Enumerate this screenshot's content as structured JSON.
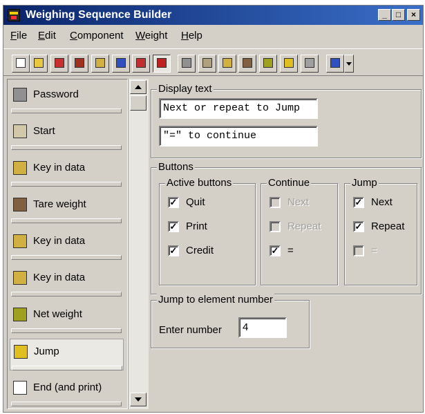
{
  "window": {
    "title": "Weighing Sequence Builder",
    "controls": {
      "minimize": "_",
      "maximize": "□",
      "close": "×"
    }
  },
  "menu": [
    {
      "pre": "",
      "u": "F",
      "post": "ile"
    },
    {
      "pre": "",
      "u": "E",
      "post": "dit"
    },
    {
      "pre": "",
      "u": "C",
      "post": "omponent"
    },
    {
      "pre": "",
      "u": "W",
      "post": "eight"
    },
    {
      "pre": "",
      "u": "H",
      "post": "elp"
    }
  ],
  "toolbar": {
    "buttons": [
      {
        "name": "new-file-icon",
        "color": "#ffffff"
      },
      {
        "name": "open-folder-icon",
        "color": "#e8c840"
      },
      {
        "name": "save-icon",
        "color": "#c83030"
      },
      {
        "name": "delete-icon",
        "color": "#a03020"
      },
      {
        "name": "properties-icon",
        "color": "#d0b040"
      },
      {
        "name": "move-up-icon",
        "color": "#3050c0"
      },
      {
        "name": "move-down-icon",
        "color": "#c03030"
      },
      {
        "name": "pointer-icon",
        "color": "#c02020"
      },
      {
        "name": "password-tool-icon",
        "color": "#909090"
      },
      {
        "name": "start-tool-icon",
        "color": "#b0a080"
      },
      {
        "name": "key-in-data-tool-icon",
        "color": "#d0b040"
      },
      {
        "name": "tare-weight-tool-icon",
        "color": "#806040"
      },
      {
        "name": "net-weight-tool-icon",
        "color": "#a0a020"
      },
      {
        "name": "jump-tool-icon",
        "color": "#e0c020"
      },
      {
        "name": "end-print-tool-icon",
        "color": "#a0a0a0"
      },
      {
        "name": "text-tool-icon",
        "color": "#3050c0"
      }
    ]
  },
  "components": [
    {
      "label": "Password",
      "icon": "password-icon",
      "color": "#909090"
    },
    {
      "label": "Start",
      "icon": "start-icon",
      "color": "#d0c8a8"
    },
    {
      "label": "Key in data",
      "icon": "key-in-data-icon",
      "color": "#d0b040"
    },
    {
      "label": "Tare weight",
      "icon": "tare-weight-icon",
      "color": "#806040"
    },
    {
      "label": "Key in data",
      "icon": "key-in-data-icon",
      "color": "#d0b040"
    },
    {
      "label": "Key in data",
      "icon": "key-in-data-icon",
      "color": "#d0b040"
    },
    {
      "label": "Net weight",
      "icon": "net-weight-icon",
      "color": "#a0a020"
    },
    {
      "label": "Jump",
      "icon": "jump-icon",
      "color": "#e0c020"
    },
    {
      "label": "End (and print)",
      "icon": "end-print-icon",
      "color": "#ffffff"
    }
  ],
  "display_text": {
    "label": "Display text",
    "line1": "Next or repeat to Jump",
    "line2": "\"=\" to continue"
  },
  "buttons_group": {
    "label": "Buttons",
    "active": {
      "label": "Active buttons",
      "items": [
        {
          "label": "Quit",
          "checked": true,
          "enabled": true
        },
        {
          "label": "Print",
          "checked": true,
          "enabled": true
        },
        {
          "label": "Credit",
          "checked": true,
          "enabled": true
        }
      ]
    },
    "continue": {
      "label": "Continue",
      "items": [
        {
          "label": "Next",
          "checked": false,
          "enabled": false
        },
        {
          "label": "Repeat",
          "checked": false,
          "enabled": false
        },
        {
          "label": "=",
          "checked": true,
          "enabled": true
        }
      ]
    },
    "jump": {
      "label": "Jump",
      "items": [
        {
          "label": "Next",
          "checked": true,
          "enabled": true
        },
        {
          "label": "Repeat",
          "checked": true,
          "enabled": true
        },
        {
          "label": "=",
          "checked": false,
          "enabled": false
        }
      ]
    }
  },
  "jump_to": {
    "label": "Jump to element number",
    "field_label": "Enter number",
    "value": "4"
  }
}
